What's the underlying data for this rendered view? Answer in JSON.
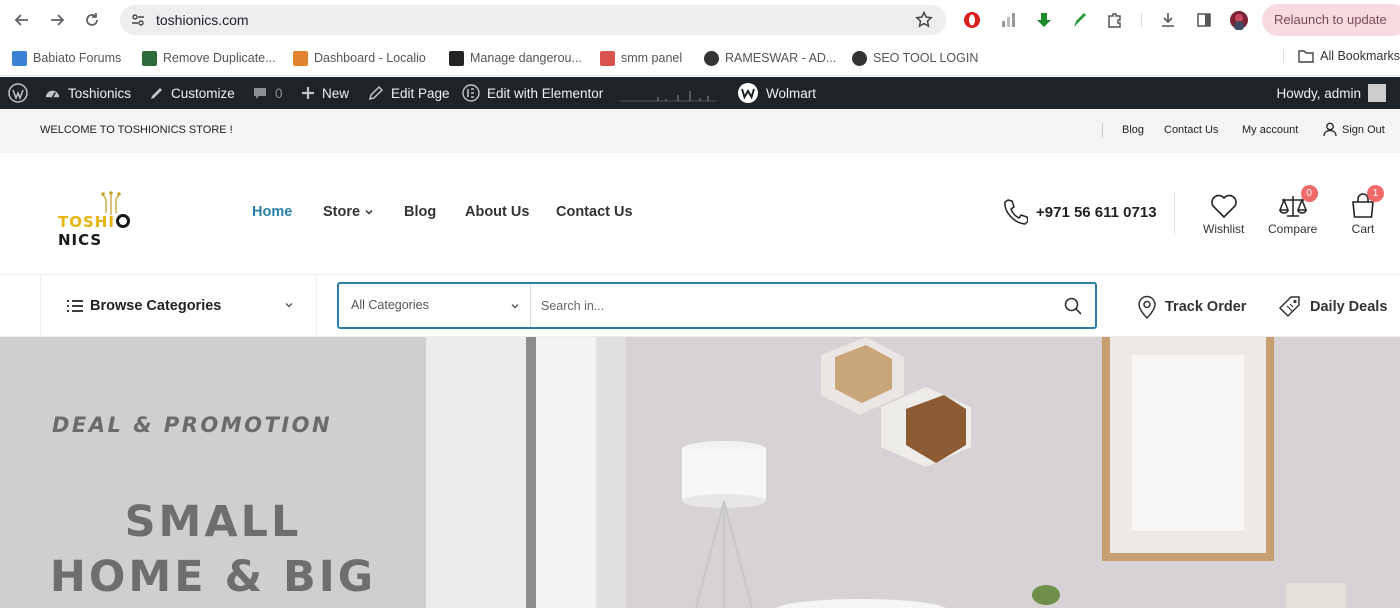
{
  "browser": {
    "url": "toshionics.com",
    "relaunch_label": "Relaunch to update",
    "bookmarks": [
      {
        "label": "Babiato Forums",
        "color": "#3b82d6"
      },
      {
        "label": "Remove Duplicate...",
        "color": "#2f6b3a"
      },
      {
        "label": "Dashboard - Localio",
        "color": "#e2842d"
      },
      {
        "label": "Manage dangerou...",
        "color": "#222222"
      },
      {
        "label": "smm panel",
        "color": "#d9534f"
      },
      {
        "label": "RAMESWAR - AD...",
        "color": "#333333"
      },
      {
        "label": "SEO TOOL LOGIN",
        "color": "#333333"
      }
    ],
    "all_bookmarks_label": "All Bookmarks"
  },
  "adminbar": {
    "site": "Toshionics",
    "customize": "Customize",
    "comments": "0",
    "new": "New",
    "edit_page": "Edit Page",
    "edit_elementor": "Edit with Elementor",
    "theme": "Wolmart",
    "howdy": "Howdy, admin"
  },
  "topbar": {
    "welcome": "WELCOME TO TOSHIONICS STORE !",
    "links": [
      "Blog",
      "Contact Us",
      "My account",
      "Sign Out"
    ]
  },
  "header": {
    "logo": {
      "part1": "TOSHI",
      "part2": "NICS"
    },
    "nav": [
      "Home",
      "Store",
      "Blog",
      "About Us",
      "Contact Us"
    ],
    "phone": "+971 56 611 0713",
    "wishlist": "Wishlist",
    "compare": "Compare",
    "compare_count": "0",
    "cart": "Cart",
    "cart_count": "1"
  },
  "catbar": {
    "browse": "Browse Categories",
    "all_categories": "All Categories",
    "search_placeholder": "Search in...",
    "track_order": "Track Order",
    "daily_deals": "Daily Deals"
  },
  "hero": {
    "subtitle": "DEAL & PROMOTION",
    "line1": "SMALL",
    "line2": "HOME & BIG"
  },
  "colors": {
    "accent": "#2a7fa8",
    "admin_bar": "#1d2327",
    "logo_yellow": "#e7b30c",
    "badge": "#f06a6a"
  }
}
